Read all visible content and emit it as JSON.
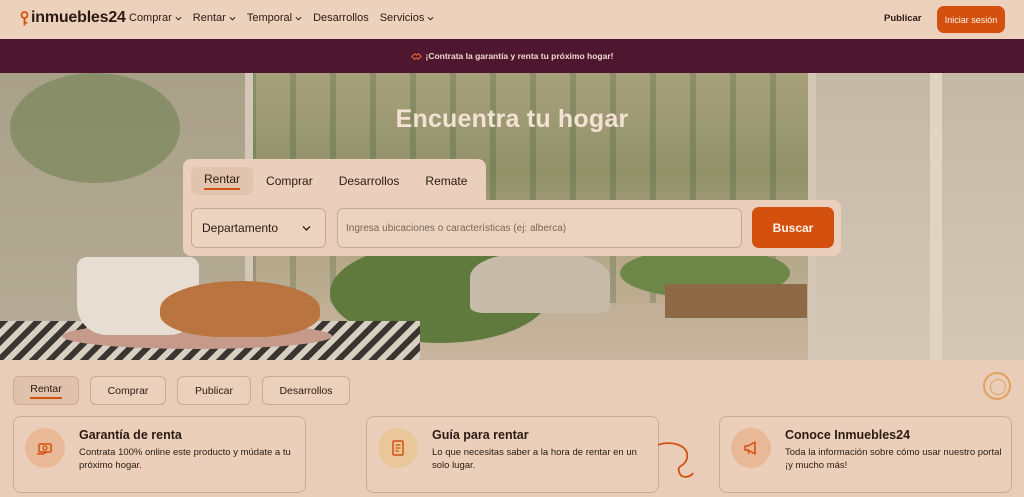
{
  "header": {
    "logo_text": "inmuebles24",
    "nav": [
      {
        "label": "Comprar",
        "has_dropdown": true
      },
      {
        "label": "Rentar",
        "has_dropdown": true
      },
      {
        "label": "Temporal",
        "has_dropdown": true
      },
      {
        "label": "Desarrollos",
        "has_dropdown": false
      },
      {
        "label": "Servicios",
        "has_dropdown": true
      }
    ],
    "publicar_label": "Publicar",
    "login_label": "Iniciar sesión"
  },
  "promo": {
    "text": "¡Contrata la garantía y renta tu próximo hogar!"
  },
  "hero": {
    "title": "Encuentra tu hogar",
    "tabs": [
      "Rentar",
      "Comprar",
      "Desarrollos",
      "Remate"
    ],
    "active_tab": "Rentar",
    "property_type": "Departamento",
    "search_placeholder": "Ingresa ubicaciones o características (ej: alberca)",
    "search_button": "Buscar"
  },
  "quick_links": {
    "chips": [
      "Rentar",
      "Comprar",
      "Publicar",
      "Desarrollos"
    ],
    "active": "Rentar"
  },
  "cards": [
    {
      "title": "Garantía de renta",
      "description": "Contrata 100% online este producto y múdate a tu próximo hogar.",
      "icon": "money-hand-icon"
    },
    {
      "title": "Guía para rentar",
      "description": "Lo que necesitas saber a la hora de rentar en un solo lugar.",
      "icon": "guide-document-icon"
    },
    {
      "title": "Conoce Inmuebles24",
      "description": "Toda la información sobre cómo usar nuestro portal ¡y mucho más!",
      "icon": "megaphone-icon"
    }
  ],
  "colors": {
    "accent": "#d3500f",
    "promo_bg": "#4f1630",
    "page_bg": "#e9cdb8"
  }
}
